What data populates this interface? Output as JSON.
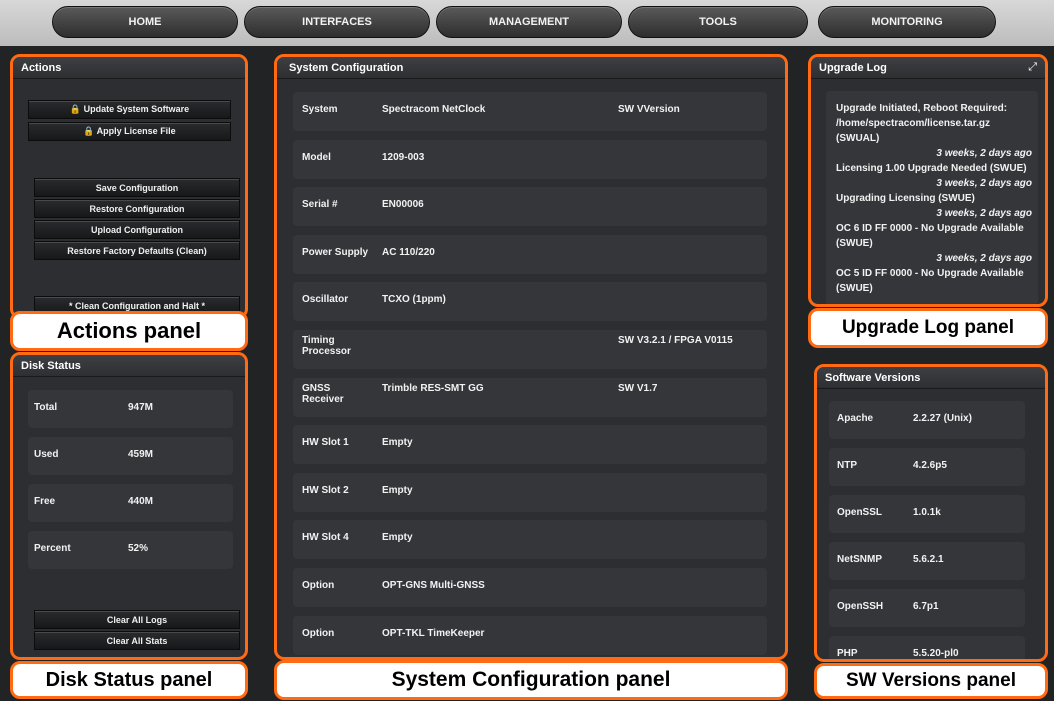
{
  "nav": [
    "HOME",
    "INTERFACES",
    "MANAGEMENT",
    "TOOLS",
    "MONITORING"
  ],
  "actions": {
    "title": "Actions",
    "buttons": [
      "🔒 Update System Software",
      "🔒 Apply License File",
      "Save Configuration",
      "Restore Configuration",
      "Upload Configuration",
      "Restore Factory Defaults (Clean)",
      "* Clean Configuration and Halt *"
    ],
    "callout": "Actions panel"
  },
  "disk": {
    "title": "Disk Status",
    "rows": [
      {
        "label": "Total",
        "value": "947M"
      },
      {
        "label": "Used",
        "value": "459M"
      },
      {
        "label": "Free",
        "value": "440M"
      },
      {
        "label": "Percent",
        "value": "52%"
      }
    ],
    "buttons": [
      "Clear All Logs",
      "Clear All Stats"
    ],
    "callout": "Disk Status panel"
  },
  "sysconfig": {
    "title": "System Configuration",
    "rows": [
      {
        "label": "System",
        "value": "Spectracom NetClock",
        "extra": "SW VVersion"
      },
      {
        "label": "Model",
        "value": "1209-003",
        "extra": ""
      },
      {
        "label": "Serial #",
        "value": "EN00006",
        "extra": ""
      },
      {
        "label": "Power Supply",
        "value": "AC 110/220",
        "extra": ""
      },
      {
        "label": "Oscillator",
        "value": "TCXO (1ppm)",
        "extra": ""
      },
      {
        "label": "Timing Processor",
        "value": "",
        "extra": "SW V3.2.1 / FPGA V0115"
      },
      {
        "label": "GNSS Receiver",
        "value": "Trimble RES-SMT GG",
        "extra": "SW V1.7"
      },
      {
        "label": "HW Slot 1",
        "value": "Empty",
        "extra": ""
      },
      {
        "label": "HW Slot 2",
        "value": "Empty",
        "extra": ""
      },
      {
        "label": "HW Slot 4",
        "value": "Empty",
        "extra": ""
      },
      {
        "label": "Option",
        "value": "OPT-GNS Multi-GNSS",
        "extra": ""
      },
      {
        "label": "Option",
        "value": "OPT-TKL TimeKeeper",
        "extra": ""
      }
    ],
    "callout": "System Configuration panel"
  },
  "upgrade": {
    "title": "Upgrade Log",
    "entries": [
      {
        "text": "Upgrade Initiated, Reboot Required: /home/spectracom/license.tar.gz (SWUAL)",
        "time": "3 weeks, 2 days ago"
      },
      {
        "text": "Licensing 1.00 Upgrade Needed (SWUE)",
        "time": "3 weeks, 2 days ago"
      },
      {
        "text": "Upgrading Licensing (SWUE)",
        "time": "3 weeks, 2 days ago"
      },
      {
        "text": "OC 6 ID FF 0000 - No Upgrade Available (SWUE)",
        "time": "3 weeks, 2 days ago"
      },
      {
        "text": "OC 5 ID FF 0000 - No Upgrade Available (SWUE)",
        "time": ""
      }
    ],
    "callout": "Upgrade Log panel"
  },
  "versions": {
    "title": "Software Versions",
    "rows": [
      {
        "label": "Apache",
        "value": "2.2.27 (Unix)"
      },
      {
        "label": "NTP",
        "value": "4.2.6p5"
      },
      {
        "label": "OpenSSL",
        "value": "1.0.1k"
      },
      {
        "label": "NetSNMP",
        "value": "5.6.2.1"
      },
      {
        "label": "OpenSSH",
        "value": "6.7p1"
      },
      {
        "label": "PHP",
        "value": "5.5.20-pl0"
      }
    ],
    "callout": "SW Versions panel"
  }
}
